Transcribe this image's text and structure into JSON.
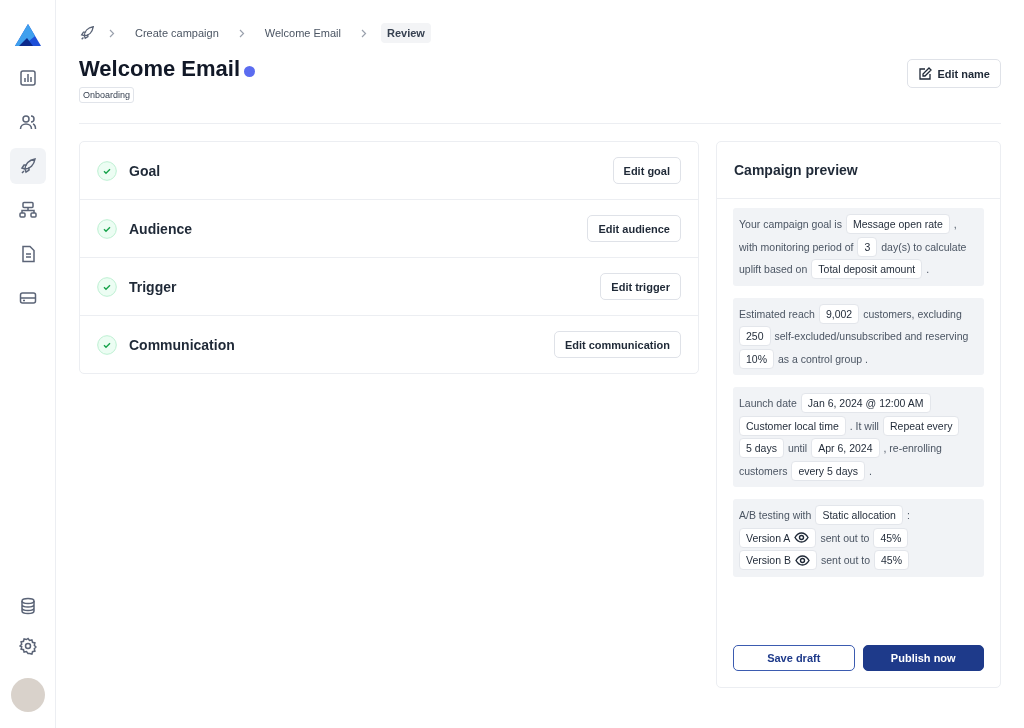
{
  "sidebar": {
    "nav_items": [
      {
        "selected": false
      },
      {
        "selected": false
      },
      {
        "selected": true
      },
      {
        "selected": false
      },
      {
        "selected": false
      },
      {
        "selected": false
      }
    ]
  },
  "breadcrumb": [
    {
      "label": "Create campaign",
      "selected": false
    },
    {
      "label": "Welcome Email",
      "selected": false
    },
    {
      "label": "Review",
      "selected": true
    }
  ],
  "header": {
    "title": "Welcome Email",
    "tag": "Onboarding",
    "edit_button": "Edit name"
  },
  "steps": [
    {
      "title": "Goal",
      "done": true,
      "button": "Edit goal"
    },
    {
      "title": "Audience",
      "done": true,
      "button": "Edit audience"
    },
    {
      "title": "Trigger",
      "done": true,
      "button": "Edit trigger"
    },
    {
      "title": "Communication",
      "done": true,
      "button": "Edit communication"
    }
  ],
  "preview": {
    "title": "Campaign preview",
    "blocks": [
      {
        "lines": [
          [
            {
              "kind": "text",
              "text": "Your campaign goal is"
            },
            {
              "kind": "chip",
              "text": "Message open rate"
            },
            {
              "kind": "text",
              "text": ","
            }
          ],
          [
            {
              "kind": "text",
              "text": "with monitoring period of"
            },
            {
              "kind": "chip",
              "text": "3"
            },
            {
              "kind": "text",
              "text": "day(s) to calculate"
            }
          ],
          [
            {
              "kind": "text",
              "text": "uplift based on"
            },
            {
              "kind": "chip",
              "text": "Total deposit amount"
            },
            {
              "kind": "text",
              "text": "."
            }
          ]
        ]
      },
      {
        "lines": [
          [
            {
              "kind": "text",
              "text": "Estimated reach"
            },
            {
              "kind": "chip",
              "text": "9,002"
            },
            {
              "kind": "text",
              "text": "customers, excluding"
            }
          ],
          [
            {
              "kind": "chip",
              "text": "250"
            },
            {
              "kind": "text",
              "text": "self-excluded/unsubscribed and reserving"
            }
          ],
          [
            {
              "kind": "chip",
              "text": "10%"
            },
            {
              "kind": "text",
              "text": "as a control group ."
            }
          ]
        ]
      },
      {
        "lines": [
          [
            {
              "kind": "text",
              "text": "Launch date"
            },
            {
              "kind": "chip",
              "text": "Jan 6, 2024 @ 12:00 AM"
            }
          ],
          [
            {
              "kind": "chip",
              "text": "Customer local time"
            },
            {
              "kind": "text",
              "text": ". It will"
            },
            {
              "kind": "chip",
              "text": "Repeat every"
            }
          ],
          [
            {
              "kind": "chip",
              "text": "5 days"
            },
            {
              "kind": "text",
              "text": "until"
            },
            {
              "kind": "chip",
              "text": "Apr 6, 2024"
            },
            {
              "kind": "text",
              "text": ", re-enrolling"
            }
          ],
          [
            {
              "kind": "text",
              "text": "customers"
            },
            {
              "kind": "chip",
              "text": "every 5 days"
            },
            {
              "kind": "text",
              "text": "."
            }
          ]
        ]
      },
      {
        "lines": [
          [
            {
              "kind": "text",
              "text": "A/B testing with"
            },
            {
              "kind": "chip",
              "text": "Static allocation"
            },
            {
              "kind": "text",
              "text": ":"
            }
          ],
          [
            {
              "kind": "chip_eye",
              "text": "Version A"
            },
            {
              "kind": "text",
              "text": "sent out to"
            },
            {
              "kind": "chip",
              "text": "45%"
            }
          ],
          [
            {
              "kind": "chip_eye",
              "text": "Version B"
            },
            {
              "kind": "text",
              "text": "sent out to"
            },
            {
              "kind": "chip",
              "text": "45%"
            }
          ]
        ]
      }
    ],
    "save_button": "Save draft",
    "publish_button": "Publish now"
  }
}
